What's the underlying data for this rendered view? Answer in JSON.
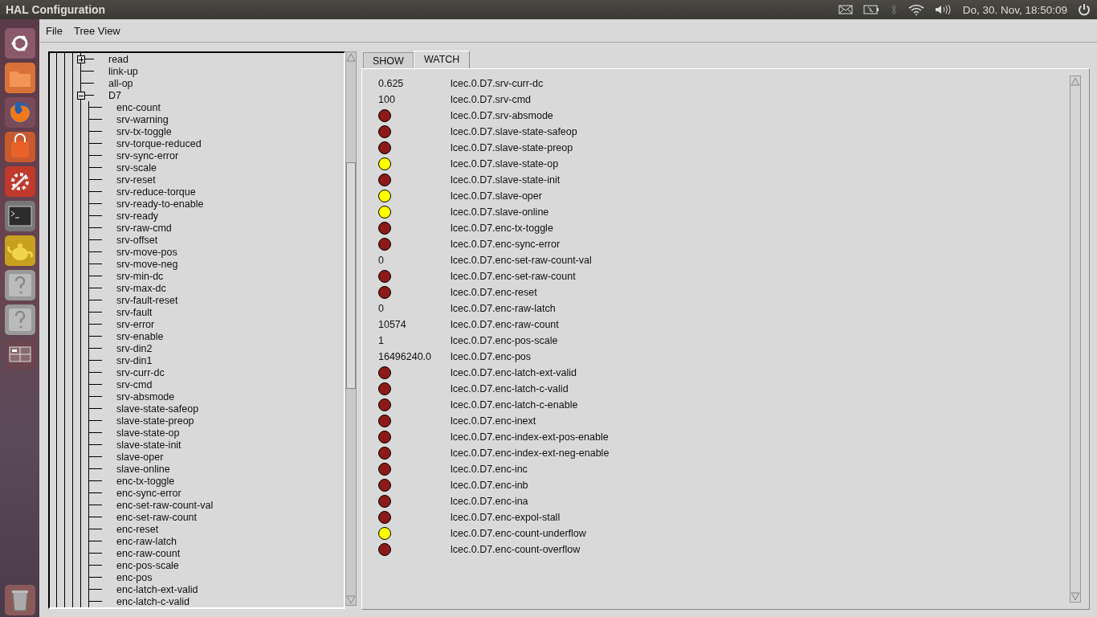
{
  "top_bar": {
    "title": "HAL Configuration",
    "clock": "Do, 30. Nov, 18:50:09"
  },
  "launcher": [
    {
      "kind": "ubuntu"
    },
    {
      "kind": "files"
    },
    {
      "kind": "browser"
    },
    {
      "kind": "store"
    },
    {
      "kind": "settings"
    },
    {
      "kind": "terminal"
    },
    {
      "kind": "teapot"
    },
    {
      "kind": "unknown"
    },
    {
      "kind": "unknown"
    },
    {
      "kind": "workspaces"
    },
    {
      "kind": "trash"
    }
  ],
  "menu": [
    "File",
    "Tree View"
  ],
  "tree": {
    "items": [
      {
        "label": "read",
        "kind": "folder",
        "expanded": false
      },
      {
        "label": "link-up",
        "kind": "leaf"
      },
      {
        "label": "all-op",
        "kind": "leaf"
      },
      {
        "label": "D7",
        "kind": "folder",
        "expanded": true,
        "children": [
          {
            "label": "enc-count"
          },
          {
            "label": "srv-warning"
          },
          {
            "label": "srv-tx-toggle"
          },
          {
            "label": "srv-torque-reduced"
          },
          {
            "label": "srv-sync-error"
          },
          {
            "label": "srv-scale"
          },
          {
            "label": "srv-reset"
          },
          {
            "label": "srv-reduce-torque"
          },
          {
            "label": "srv-ready-to-enable"
          },
          {
            "label": "srv-ready"
          },
          {
            "label": "srv-raw-cmd"
          },
          {
            "label": "srv-offset"
          },
          {
            "label": "srv-move-pos"
          },
          {
            "label": "srv-move-neg"
          },
          {
            "label": "srv-min-dc"
          },
          {
            "label": "srv-max-dc"
          },
          {
            "label": "srv-fault-reset"
          },
          {
            "label": "srv-fault"
          },
          {
            "label": "srv-error"
          },
          {
            "label": "srv-enable"
          },
          {
            "label": "srv-din2"
          },
          {
            "label": "srv-din1"
          },
          {
            "label": "srv-curr-dc"
          },
          {
            "label": "srv-cmd"
          },
          {
            "label": "srv-absmode"
          },
          {
            "label": "slave-state-safeop"
          },
          {
            "label": "slave-state-preop"
          },
          {
            "label": "slave-state-op"
          },
          {
            "label": "slave-state-init"
          },
          {
            "label": "slave-oper"
          },
          {
            "label": "slave-online"
          },
          {
            "label": "enc-tx-toggle"
          },
          {
            "label": "enc-sync-error"
          },
          {
            "label": "enc-set-raw-count-val"
          },
          {
            "label": "enc-set-raw-count"
          },
          {
            "label": "enc-reset"
          },
          {
            "label": "enc-raw-latch"
          },
          {
            "label": "enc-raw-count"
          },
          {
            "label": "enc-pos-scale"
          },
          {
            "label": "enc-pos"
          },
          {
            "label": "enc-latch-ext-valid"
          },
          {
            "label": "enc-latch-c-valid"
          }
        ]
      }
    ]
  },
  "tabs": [
    {
      "label": "SHOW",
      "selected": false
    },
    {
      "label": "WATCH",
      "selected": true
    }
  ],
  "watch": [
    {
      "kind": "number",
      "value": "0.625",
      "name": "lcec.0.D7.srv-curr-dc"
    },
    {
      "kind": "number",
      "value": "100",
      "name": "lcec.0.D7.srv-cmd"
    },
    {
      "kind": "bit",
      "on": false,
      "name": "lcec.0.D7.srv-absmode"
    },
    {
      "kind": "bit",
      "on": false,
      "name": "lcec.0.D7.slave-state-safeop"
    },
    {
      "kind": "bit",
      "on": false,
      "name": "lcec.0.D7.slave-state-preop"
    },
    {
      "kind": "bit",
      "on": true,
      "name": "lcec.0.D7.slave-state-op"
    },
    {
      "kind": "bit",
      "on": false,
      "name": "lcec.0.D7.slave-state-init"
    },
    {
      "kind": "bit",
      "on": true,
      "name": "lcec.0.D7.slave-oper"
    },
    {
      "kind": "bit",
      "on": true,
      "name": "lcec.0.D7.slave-online"
    },
    {
      "kind": "bit",
      "on": false,
      "name": "lcec.0.D7.enc-tx-toggle"
    },
    {
      "kind": "bit",
      "on": false,
      "name": "lcec.0.D7.enc-sync-error"
    },
    {
      "kind": "number",
      "value": "0",
      "name": "lcec.0.D7.enc-set-raw-count-val"
    },
    {
      "kind": "bit",
      "on": false,
      "name": "lcec.0.D7.enc-set-raw-count"
    },
    {
      "kind": "bit",
      "on": false,
      "name": "lcec.0.D7.enc-reset"
    },
    {
      "kind": "number",
      "value": "0",
      "name": "lcec.0.D7.enc-raw-latch"
    },
    {
      "kind": "number",
      "value": "10574",
      "name": "lcec.0.D7.enc-raw-count"
    },
    {
      "kind": "number",
      "value": "1",
      "name": "lcec.0.D7.enc-pos-scale"
    },
    {
      "kind": "number",
      "value": "16496240.0",
      "name": "lcec.0.D7.enc-pos"
    },
    {
      "kind": "bit",
      "on": false,
      "name": "lcec.0.D7.enc-latch-ext-valid"
    },
    {
      "kind": "bit",
      "on": false,
      "name": "lcec.0.D7.enc-latch-c-valid"
    },
    {
      "kind": "bit",
      "on": false,
      "name": "lcec.0.D7.enc-latch-c-enable"
    },
    {
      "kind": "bit",
      "on": false,
      "name": "lcec.0.D7.enc-inext"
    },
    {
      "kind": "bit",
      "on": false,
      "name": "lcec.0.D7.enc-index-ext-pos-enable"
    },
    {
      "kind": "bit",
      "on": false,
      "name": "lcec.0.D7.enc-index-ext-neg-enable"
    },
    {
      "kind": "bit",
      "on": false,
      "name": "lcec.0.D7.enc-inc"
    },
    {
      "kind": "bit",
      "on": false,
      "name": "lcec.0.D7.enc-inb"
    },
    {
      "kind": "bit",
      "on": false,
      "name": "lcec.0.D7.enc-ina"
    },
    {
      "kind": "bit",
      "on": false,
      "name": "lcec.0.D7.enc-expol-stall"
    },
    {
      "kind": "bit",
      "on": true,
      "name": "lcec.0.D7.enc-count-underflow"
    },
    {
      "kind": "bit",
      "on": false,
      "name": "lcec.0.D7.enc-count-overflow"
    }
  ]
}
